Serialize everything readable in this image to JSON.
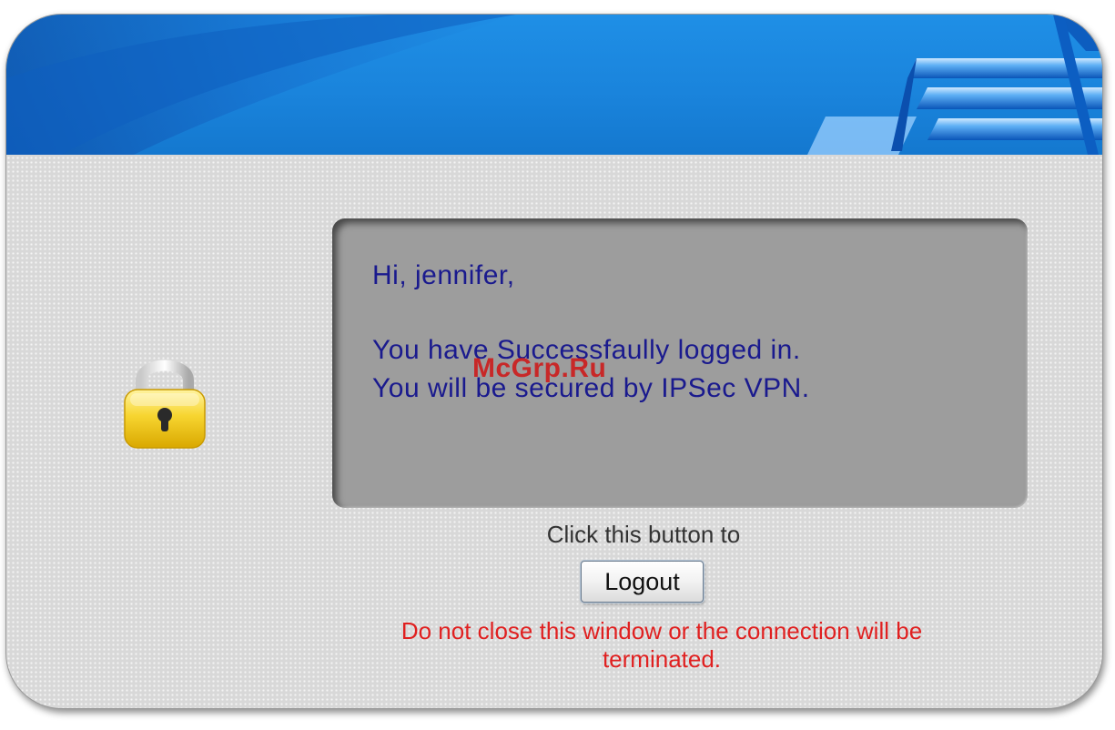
{
  "message": {
    "greeting": "Hi, jennifer,",
    "line1": "You have Successfaully logged in.",
    "line2": "You will be secured by IPSec VPN."
  },
  "watermark": "McGrp.Ru",
  "instruction": "Click this button to",
  "logout_button": {
    "label": "Logout"
  },
  "warning": "Do not close this window or the connection will be terminated.",
  "icons": {
    "lock": "padlock-icon",
    "banner": "banner-graphic"
  },
  "colors": {
    "banner_blue": "#1a84dc",
    "message_text": "#1a1a8e",
    "warning_text": "#e02020",
    "watermark": "#cc1f1f"
  }
}
